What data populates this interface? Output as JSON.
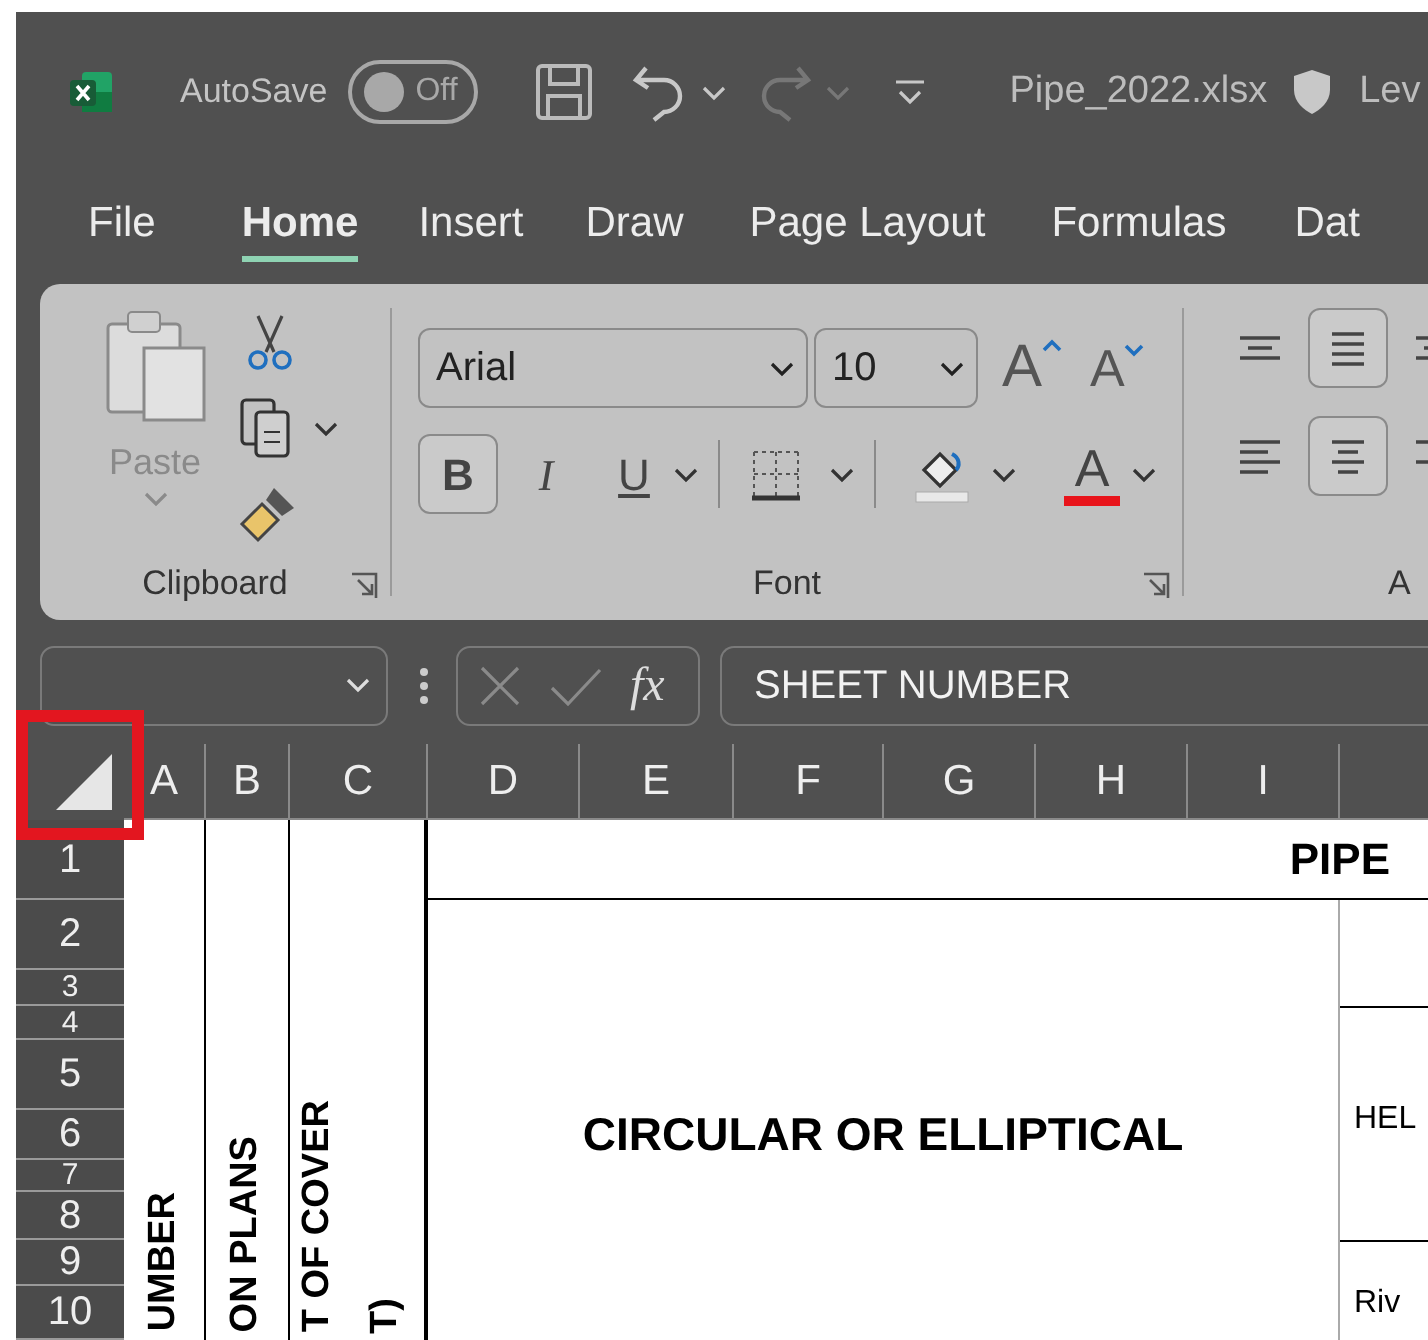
{
  "title_bar": {
    "autosave_label": "AutoSave",
    "autosave": {
      "label": "Off",
      "on": false
    },
    "file_name": "Pipe_2022.xlsx",
    "sensitivity": "Lev"
  },
  "menu_tabs": [
    {
      "label": "File",
      "selected": false
    },
    {
      "label": "Home",
      "selected": true
    },
    {
      "label": "Insert",
      "selected": false
    },
    {
      "label": "Draw",
      "selected": false
    },
    {
      "label": "Page Layout",
      "selected": false
    },
    {
      "label": "Formulas",
      "selected": false
    },
    {
      "label": "Dat",
      "selected": false
    }
  ],
  "ribbon": {
    "clipboard": {
      "label": "Clipboard",
      "paste_label": "Paste",
      "paste_disabled": true
    },
    "font": {
      "label": "Font",
      "font_name": "Arial",
      "font_size": "10",
      "size_tools": [
        {
          "kind": "grow",
          "glyph": "A"
        },
        {
          "kind": "shrink",
          "glyph": "A"
        }
      ],
      "format_buttons": [
        {
          "kind": "bold",
          "label": "B",
          "selected": true
        },
        {
          "kind": "italic",
          "label": "I",
          "selected": false
        },
        {
          "kind": "underline",
          "label": "U",
          "selected": false
        }
      ],
      "font_color_glyph": "A"
    },
    "alignment": {
      "label": "A",
      "buttons": [
        {
          "kind": "top",
          "selected": false
        },
        {
          "kind": "middle",
          "selected": true
        },
        {
          "kind": "bottom",
          "selected": false
        },
        {
          "kind": "left",
          "selected": false
        },
        {
          "kind": "center",
          "selected": true
        },
        {
          "kind": "right",
          "selected": false
        }
      ]
    }
  },
  "formula_bar": {
    "function_glyph": "fx",
    "formula": "SHEET NUMBER"
  },
  "sheet": {
    "select_all_highlighted": true,
    "columns": [
      "A",
      "B",
      "C",
      "D",
      "E",
      "F",
      "G",
      "H",
      "I"
    ],
    "rows": [
      "1",
      "2",
      "3",
      "4",
      "5",
      "6",
      "7",
      "8",
      "9",
      "10"
    ],
    "cells": [
      {
        "text": "UMBER",
        "kind": "vertical"
      },
      {
        "text": "ON PLANS",
        "kind": "vertical"
      },
      {
        "text": "T OF COVER",
        "kind": "vertical"
      },
      {
        "text": "T)",
        "kind": "vertical"
      },
      {
        "text": "PIPE",
        "kind": "bold"
      },
      {
        "text": "CIRCULAR OR ELLIPTICAL",
        "kind": "bold"
      },
      {
        "text": "HEL",
        "kind": "plain"
      },
      {
        "text": "Riv",
        "kind": "plain"
      }
    ]
  }
}
